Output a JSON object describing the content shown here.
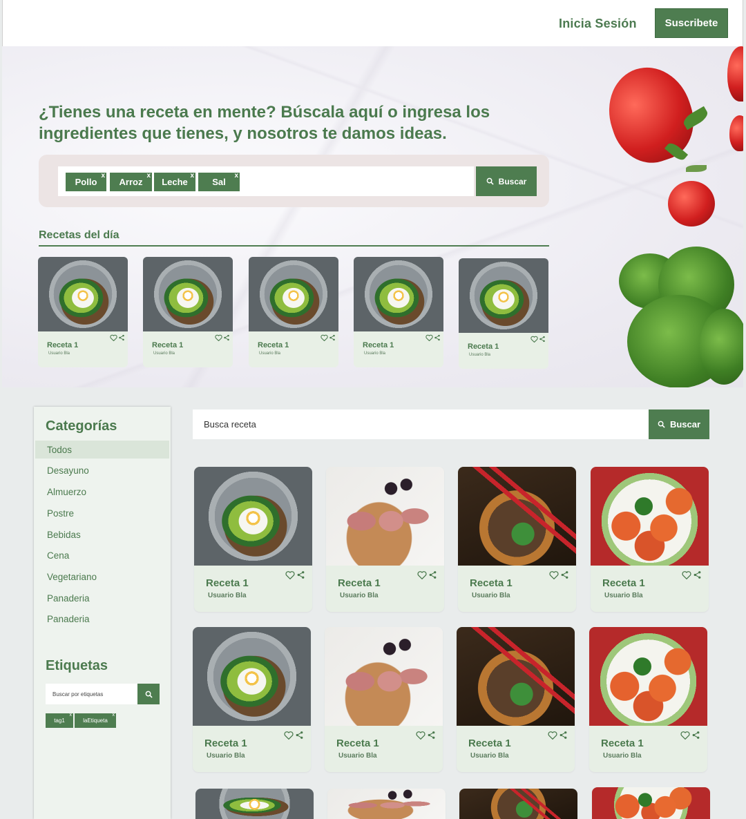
{
  "header": {
    "login_label": "Inicia Sesión",
    "subscribe_label": "Suscribete"
  },
  "hero": {
    "title": "¿Tienes una receta en mente? Búscala aquí o ingresa los ingredientes que tienes, y nosotros te damos ideas.",
    "chips": [
      "Pollo",
      "Arroz",
      "Leche",
      "Sal"
    ],
    "chip_remove": "x",
    "search_label": "Buscar",
    "section_title": "Recetas del día",
    "daily_recipes": [
      {
        "name": "Receta 1",
        "user": "Usuario Bla",
        "image": "avocado-toast"
      },
      {
        "name": "Receta 1",
        "user": "Usuario Bla",
        "image": "avocado-toast"
      },
      {
        "name": "Receta 1",
        "user": "Usuario Bla",
        "image": "avocado-toast"
      },
      {
        "name": "Receta 1",
        "user": "Usuario Bla",
        "image": "avocado-toast"
      },
      {
        "name": "Receta 1",
        "user": "Usuario Bla",
        "image": "avocado-toast"
      }
    ]
  },
  "sidebar": {
    "categories_title": "Categorías",
    "categories": [
      "Todos",
      "Desayuno",
      "Almuerzo",
      "Postre",
      "Bebidas",
      "Cena",
      "Vegetariano",
      "Panaderia",
      "Panaderia"
    ],
    "active_category": "Todos",
    "tags_title": "Etiquetas",
    "tag_search_placeholder": "Buscar por etiquetas",
    "tags": [
      "tag1",
      "laEtiqueta"
    ],
    "tag_remove": "x"
  },
  "main": {
    "search_placeholder": "Busca receta",
    "search_label": "Buscar",
    "recipes": [
      {
        "name": "Receta 1",
        "user": "Usuario Bla",
        "image": "avocado-toast"
      },
      {
        "name": "Receta 1",
        "user": "Usuario Bla",
        "image": "bacon-rolls"
      },
      {
        "name": "Receta 1",
        "user": "Usuario Bla",
        "image": "noodle-bowl"
      },
      {
        "name": "Receta 1",
        "user": "Usuario Bla",
        "image": "shrimp-plate"
      },
      {
        "name": "Receta 1",
        "user": "Usuario Bla",
        "image": "avocado-toast"
      },
      {
        "name": "Receta 1",
        "user": "Usuario Bla",
        "image": "bacon-rolls"
      },
      {
        "name": "Receta 1",
        "user": "Usuario Bla",
        "image": "noodle-bowl"
      },
      {
        "name": "Receta 1",
        "user": "Usuario Bla",
        "image": "shrimp-plate"
      }
    ],
    "partial_row_images": [
      "avocado-toast",
      "bacon-rolls",
      "noodle-bowl",
      "shrimp-plate"
    ]
  },
  "icons": {
    "like": "heart-icon",
    "share": "share-icon",
    "search": "search-icon"
  },
  "colors": {
    "brand_green": "#4e7d50",
    "card_bg": "#e7efe5",
    "page_bg": "#e9ecec",
    "hero_panel": "#ece4e4"
  }
}
